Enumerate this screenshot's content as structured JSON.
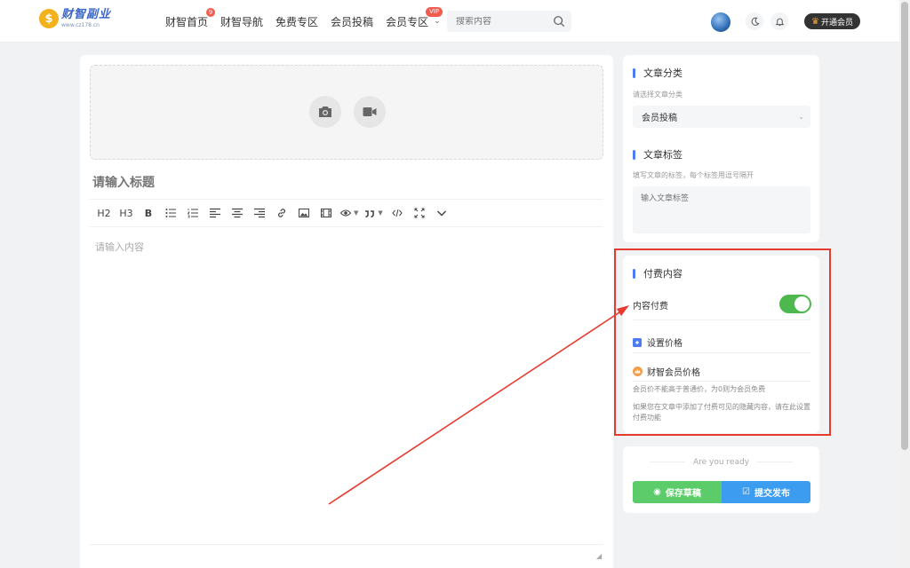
{
  "header": {
    "logo_mark": "$",
    "logo_name": "财智副业",
    "logo_url": "www.cz178.cn",
    "nav": [
      {
        "label": "财智首页",
        "badge": "9"
      },
      {
        "label": "财智导航"
      },
      {
        "label": "免费专区"
      },
      {
        "label": "会员投稿"
      },
      {
        "label": "会员专区",
        "badge": "VIP"
      }
    ],
    "nav_more_chevron": "⌄",
    "search_placeholder": "搜索内容",
    "vip_button": "开通会员",
    "vip_crown": "♛"
  },
  "editor": {
    "title_placeholder": "请输入标题",
    "content_placeholder": "请输入内容",
    "toolbar": {
      "h2": "H2",
      "h3": "H3",
      "bold": "B"
    }
  },
  "sidebar": {
    "category": {
      "title": "文章分类",
      "hint": "请选择文章分类",
      "selected": "会员投稿"
    },
    "tags": {
      "title": "文章标签",
      "hint": "填写文章的标签，每个标签用逗号隔开",
      "placeholder": "输入文章标签"
    },
    "paid": {
      "title": "付费内容",
      "toggle_label": "内容付费",
      "toggle_on": true,
      "price_label": "设置价格",
      "member_price_label": "财智会员价格",
      "note1": "会员价不能高于普通价，为0则为会员免费",
      "note2": "如果您在文章中添加了付费可见的隐藏内容，请在此设置付费功能"
    },
    "actions": {
      "ready": "Are you ready",
      "save_draft": "保存草稿",
      "submit": "提交发布"
    }
  },
  "colors": {
    "accent": "#4e7cf6",
    "toggle_on": "#4db84d",
    "save_green": "#5ccb6a",
    "submit_blue": "#3c9cf0",
    "annotation_red": "#e63a2f"
  }
}
